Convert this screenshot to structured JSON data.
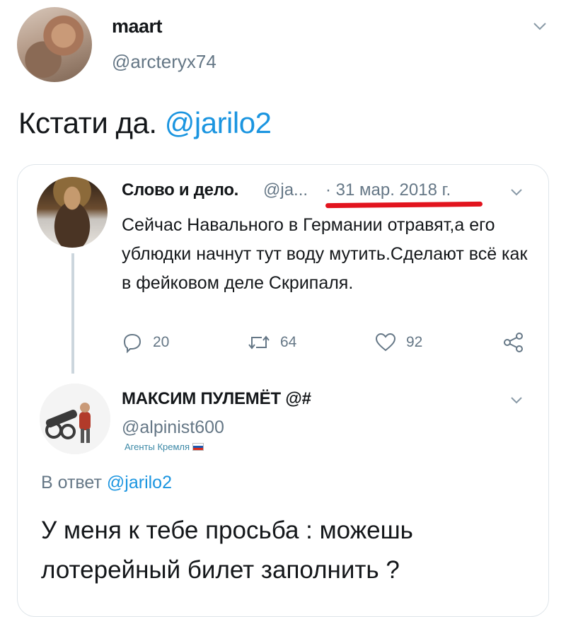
{
  "main_tweet": {
    "display_name": "maart",
    "handle": "@arcteryx74",
    "text_before": "Кстати да. ",
    "mention": "@jarilo2"
  },
  "quoted_tweet": {
    "display_name": "Слово и дело.",
    "handle": "@ja...",
    "date": "· 31 мар. 2018 г.",
    "body": "Сейчас Навального в Германии отравят,а его ублюдки начнут тут воду мутить.Сделают всё как в фейковом деле Скрипаля.",
    "reply_count": "20",
    "retweet_count": "64",
    "like_count": "92"
  },
  "reply_tweet": {
    "display_name": "МАКСИМ ПУЛЕМЁТ @#",
    "handle": "@alpinist600",
    "sublabel": "Агенты Кремля",
    "reply_prefix": "В ответ ",
    "reply_mention": "@jarilo2",
    "text": "У меня к тебе просьба : можешь лотерейный билет заполнить ?"
  },
  "colors": {
    "link": "#1b95e0",
    "secondary_text": "#657786",
    "underline": "#e2141e"
  }
}
